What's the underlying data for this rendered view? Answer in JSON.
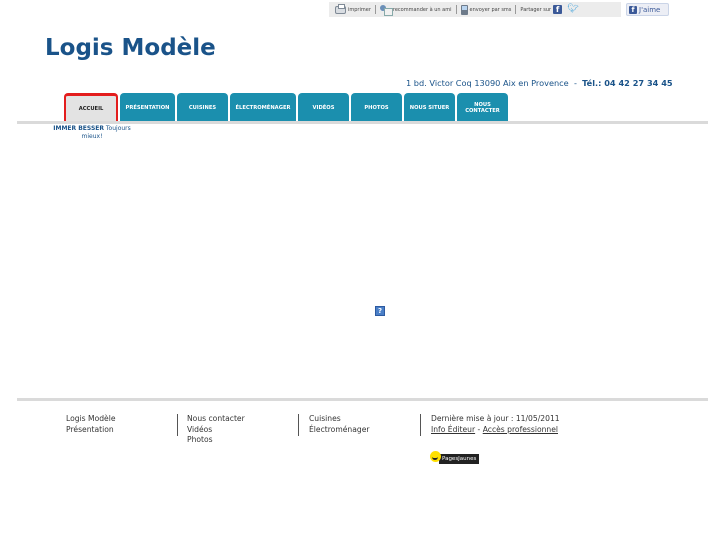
{
  "toolbar": {
    "print_label": "imprimer",
    "recommend_label": "recommander à un ami",
    "sms_label": "envoyer par sms",
    "share_label": "Partager sur",
    "fb_glyph": "f",
    "like_label": "J'aime"
  },
  "header": {
    "site_title": "Logis Modèle",
    "address": "1 bd. Victor Coq 13090 Aix en Provence",
    "separator": "-",
    "tel_label": "Tél.: 04 42 27 34 45"
  },
  "nav": {
    "tabs": [
      {
        "label": "Accueil",
        "active": true
      },
      {
        "label": "Présentation",
        "active": false
      },
      {
        "label": "Cuisines",
        "active": false
      },
      {
        "label": "Électroménager",
        "active": false
      },
      {
        "label": "Vidéos",
        "active": false
      },
      {
        "label": "Photos",
        "active": false
      },
      {
        "label": "Nous situer",
        "active": false
      },
      {
        "label": "Nous contacter",
        "active": false
      }
    ]
  },
  "tagline": {
    "brand": "IMMER BESSER",
    "text": "Toujours mieux!"
  },
  "content": {
    "help_glyph": "?"
  },
  "footer": {
    "col1": [
      "Logis Modèle",
      "Présentation"
    ],
    "col2": [
      "Nous contacter",
      "Vidéos",
      "Photos"
    ],
    "col3": [
      "Cuisines",
      "Électroménager"
    ],
    "last_update": "Dernière mise à jour : 11/05/2011",
    "info_editeur": "Info Éditeur",
    "dash": "-",
    "acces_pro": "Accès professionnel",
    "pages_jaunes": "PagesJaunes"
  },
  "colors": {
    "brand_blue": "#1a5389",
    "tab_teal": "#1b8fae",
    "active_border": "#e31d1d"
  }
}
